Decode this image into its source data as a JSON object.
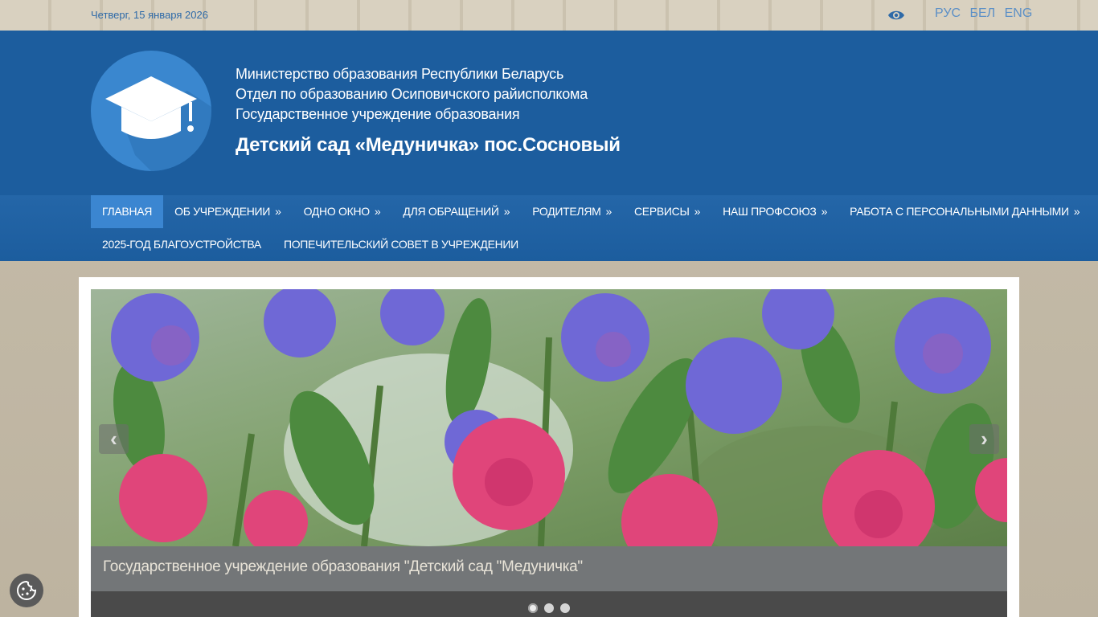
{
  "topbar": {
    "date": "Четверг, 15 января 2026",
    "languages": [
      "РУС",
      "БЕЛ",
      "ENG"
    ],
    "accessibility_icon": "eye-icon"
  },
  "header": {
    "line1": "Министерство образования Республики Беларусь",
    "line2": "Отдел по образованию Осиповичского райисполкома",
    "line3": "Государственное учреждение образования",
    "title": "Детский сад «Медуничка» пос.Сосновый",
    "logo_icon": "graduation-cap-icon"
  },
  "nav": {
    "row1": [
      {
        "label": "Главная",
        "arrow": ""
      },
      {
        "label": "Об учреждении",
        "arrow": "»"
      },
      {
        "label": "Одно окно",
        "arrow": "»"
      },
      {
        "label": "Для обращений",
        "arrow": "»"
      },
      {
        "label": "Родителям",
        "arrow": "»"
      },
      {
        "label": "Сервисы",
        "arrow": "»"
      },
      {
        "label": "Наш профсоюз",
        "arrow": "»"
      },
      {
        "label": "Работа с персональными данными",
        "arrow": "»"
      }
    ],
    "row2": [
      {
        "label": "2025-год благоустройства",
        "arrow": ""
      },
      {
        "label": "Попечительский совет в учреждении",
        "arrow": ""
      }
    ]
  },
  "slider": {
    "caption": "Государственное учреждение образования \"Детский сад \"Медуничка\"",
    "prev_label": "‹",
    "next_label": "›",
    "slide_count": 3,
    "active_slide": 1
  },
  "colors": {
    "header_blue": "#1c5d9e",
    "nav_active": "#3b86d1",
    "logo_blue": "#3a87cf"
  }
}
